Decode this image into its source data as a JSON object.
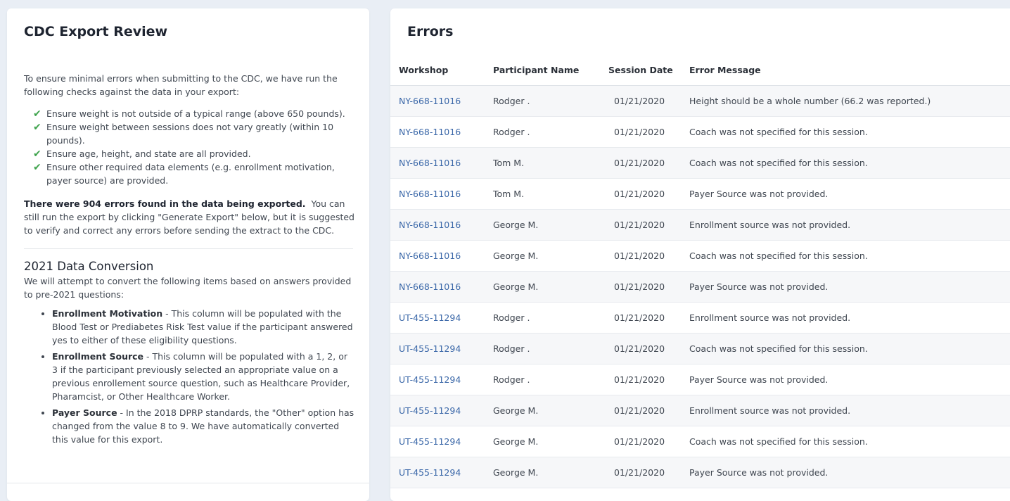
{
  "left_panel": {
    "title": "CDC Export Review",
    "intro": "To ensure minimal errors when submitting to the CDC, we have run the following checks against the data in your export:",
    "checks": [
      "Ensure weight is not outside of a typical range (above 650 pounds).",
      "Ensure weight between sessions does not vary greatly (within 10 pounds).",
      "Ensure age, height, and state are all provided.",
      "Ensure other required data elements (e.g. enrollment motivation, payer source) are provided."
    ],
    "summary_bold": "There were 904 errors found in the data being exported.",
    "summary_rest": "You can still run the export by clicking \"Generate Export\" below, but it is suggested to verify and correct any errors before sending the extract to the CDC.",
    "conversion_title": "2021 Data Conversion",
    "conversion_intro": "We will attempt to convert the following items based on answers provided to pre-2021 questions:",
    "conversion_items": [
      {
        "label": "Enrollment Motivation",
        "text": " - This column will be populated with the Blood Test or Prediabetes Risk Test value if the participant answered yes to either of these eligibility questions."
      },
      {
        "label": "Enrollment Source",
        "text": " - This column will be populated with a 1, 2, or 3 if the participant previously selected an appropriate value on a previous enrollement source question, such as Healthcare Provider, Pharamcist, or Other Healthcare Worker."
      },
      {
        "label": "Payer Source",
        "text": " - In the 2018 DPRP standards, the \"Other\" option has changed from the value 8 to 9. We have automatically converted this value for this export."
      }
    ]
  },
  "errors_panel": {
    "title": "Errors",
    "columns": [
      "Workshop",
      "Participant Name",
      "Session Date",
      "Error Message"
    ],
    "rows": [
      {
        "workshop": "NY-668-11016",
        "participant": "Rodger .",
        "date": "01/21/2020",
        "message": "Height should be a whole number (66.2 was reported.)"
      },
      {
        "workshop": "NY-668-11016",
        "participant": "Rodger .",
        "date": "01/21/2020",
        "message": "Coach was not specified for this session."
      },
      {
        "workshop": "NY-668-11016",
        "participant": "Tom M.",
        "date": "01/21/2020",
        "message": "Coach was not specified for this session."
      },
      {
        "workshop": "NY-668-11016",
        "participant": "Tom M.",
        "date": "01/21/2020",
        "message": "Payer Source was not provided."
      },
      {
        "workshop": "NY-668-11016",
        "participant": "George M.",
        "date": "01/21/2020",
        "message": "Enrollment source was not provided."
      },
      {
        "workshop": "NY-668-11016",
        "participant": "George M.",
        "date": "01/21/2020",
        "message": "Coach was not specified for this session."
      },
      {
        "workshop": "NY-668-11016",
        "participant": "George M.",
        "date": "01/21/2020",
        "message": "Payer Source was not provided."
      },
      {
        "workshop": "UT-455-11294",
        "participant": "Rodger .",
        "date": "01/21/2020",
        "message": "Enrollment source was not provided."
      },
      {
        "workshop": "UT-455-11294",
        "participant": "Rodger .",
        "date": "01/21/2020",
        "message": "Coach was not specified for this session."
      },
      {
        "workshop": "UT-455-11294",
        "participant": "Rodger .",
        "date": "01/21/2020",
        "message": "Payer Source was not provided."
      },
      {
        "workshop": "UT-455-11294",
        "participant": "George M.",
        "date": "01/21/2020",
        "message": "Enrollment source was not provided."
      },
      {
        "workshop": "UT-455-11294",
        "participant": "George M.",
        "date": "01/21/2020",
        "message": "Coach was not specified for this session."
      },
      {
        "workshop": "UT-455-11294",
        "participant": "George M.",
        "date": "01/21/2020",
        "message": "Payer Source was not provided."
      }
    ]
  },
  "colors": {
    "background": "#e9eef5",
    "card": "#ffffff",
    "link": "#3a67a8",
    "check": "#3fa34d",
    "row_stripe": "#f6f7f9"
  },
  "icons": {
    "check": "check-icon"
  }
}
